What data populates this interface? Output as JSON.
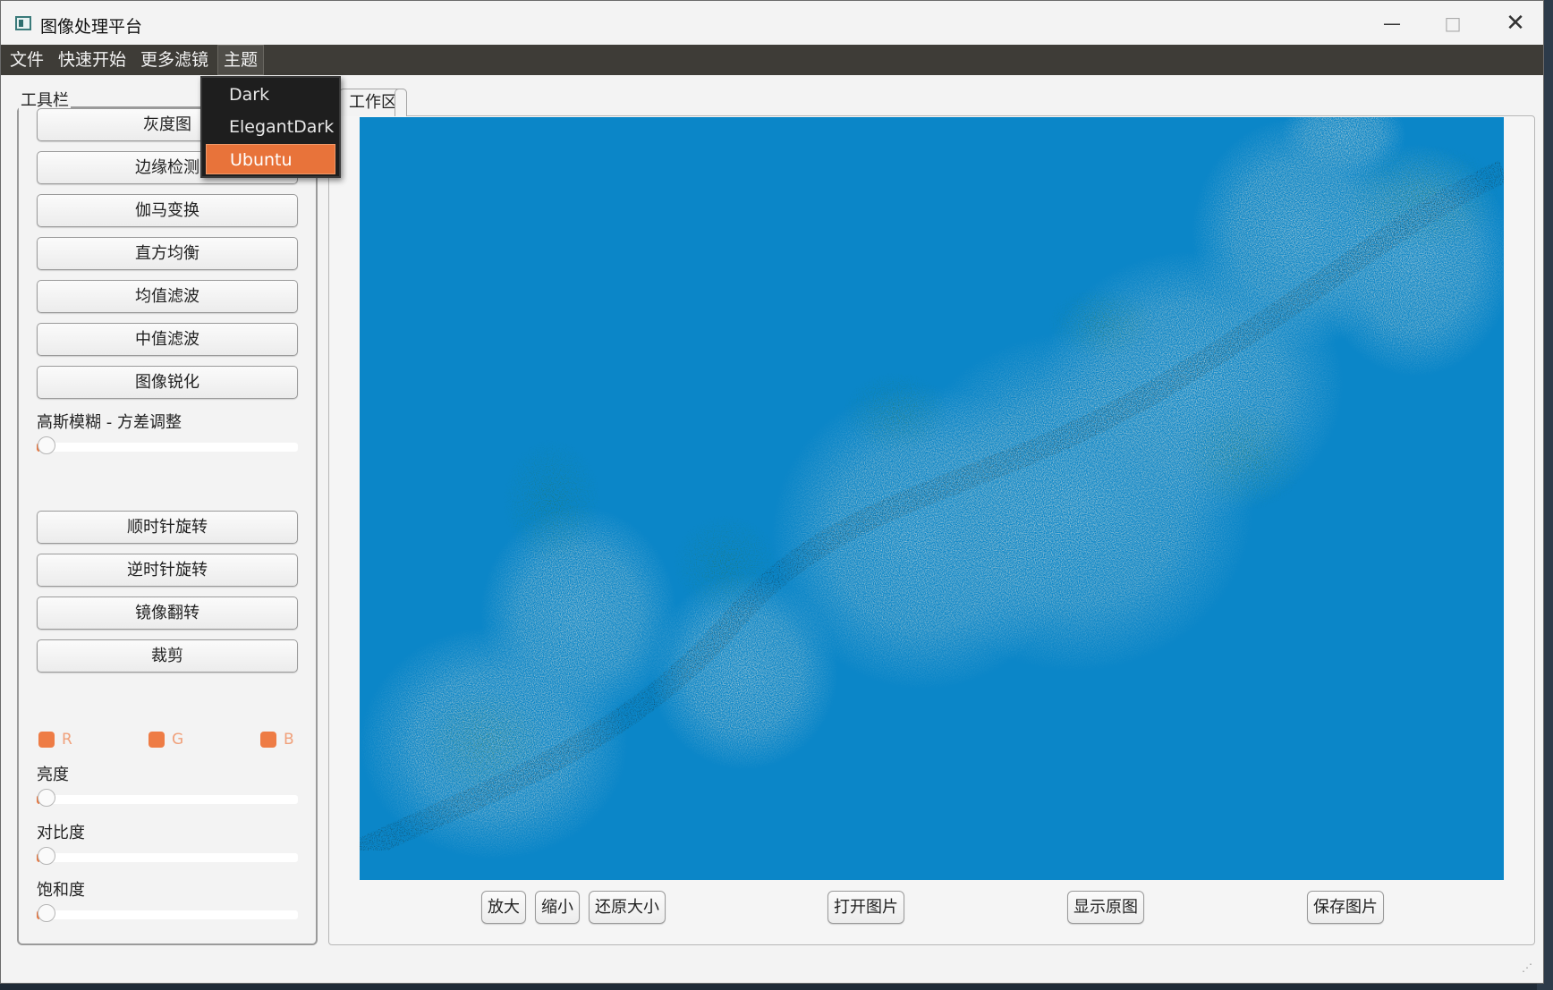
{
  "window": {
    "title": "图像处理平台"
  },
  "menubar": {
    "items": [
      "文件",
      "快速开始",
      "更多滤镜",
      "主题"
    ]
  },
  "theme_menu": {
    "items": [
      "Dark",
      "ElegantDark",
      "Ubuntu"
    ],
    "selected": "Ubuntu"
  },
  "toolbar": {
    "title": "工具栏",
    "buttons": [
      "灰度图",
      "边缘检测",
      "伽马变换",
      "直方均衡",
      "均值滤波",
      "中值滤波",
      "图像锐化"
    ],
    "gaussian_label": "高斯模糊 - 方差调整",
    "transform_buttons": [
      "顺时针旋转",
      "逆时针旋转",
      "镜像翻转",
      "裁剪"
    ],
    "channels": [
      "R",
      "G",
      "B"
    ],
    "brightness_label": "亮度",
    "contrast_label": "对比度",
    "saturation_label": "饱和度"
  },
  "workspace": {
    "tab_label": "工作区",
    "buttons": [
      "放大",
      "缩小",
      "还原大小",
      "打开图片",
      "显示原图",
      "保存图片"
    ]
  },
  "colors": {
    "accent": "#e8733a",
    "menubar": "#3e3c37",
    "image_sky": "#0a87c9"
  }
}
